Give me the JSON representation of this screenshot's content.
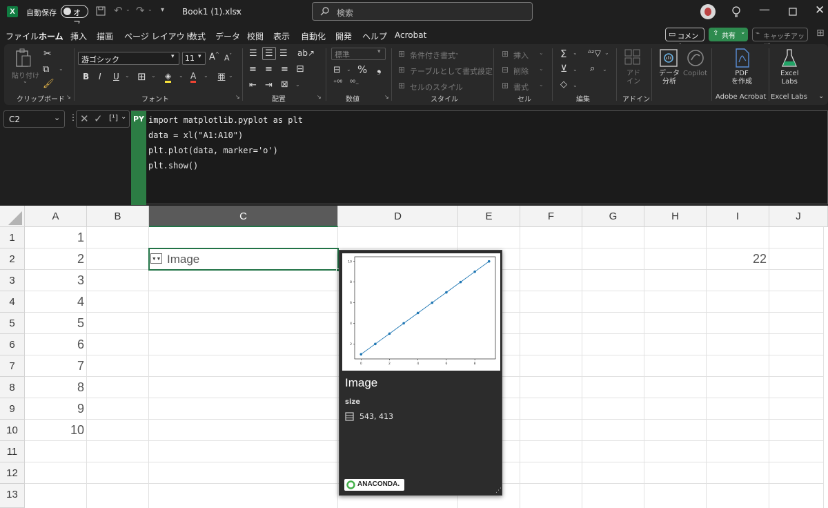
{
  "titlebar": {
    "autosave_label": "自動保存",
    "autosave_state": "オフ",
    "filename": "Book1 (1).xlsx",
    "search_placeholder": "検索"
  },
  "menu": {
    "tabs": [
      "ファイル",
      "ホーム",
      "挿入",
      "描画",
      "ページ レイアウト",
      "数式",
      "データ",
      "校閲",
      "表示",
      "自動化",
      "開発",
      "ヘルプ",
      "Acrobat"
    ],
    "active_tab": "ホーム",
    "comment_label": "コメント",
    "share_label": "共有",
    "catchup_label": "キャッチアップ"
  },
  "ribbon": {
    "paste_label": "貼り付け",
    "groups": {
      "clipboard": "クリップボード",
      "font": "フォント",
      "alignment": "配置",
      "number": "数値",
      "style": "スタイル",
      "cells": "セル",
      "editing": "編集",
      "addins": "アドイン",
      "acrobat": "Adobe Acrobat",
      "excellabs": "Excel Labs"
    },
    "font_name": "游ゴシック",
    "font_size": "11",
    "number_format": "標準",
    "conditional_format": "条件付き書式",
    "format_as_table": "テーブルとして書式設定",
    "cell_style": "セルのスタイル",
    "insert": "挿入",
    "delete": "削除",
    "format": "書式",
    "addin_label": "アド\nイン",
    "data_analysis": "データ\n分析",
    "copilot": "Copilot",
    "pdf_create": "PDF\nを作成",
    "excel_labs": "Excel\nLabs"
  },
  "formula": {
    "namebox": "C2",
    "py_badge": "PY",
    "lines": [
      "import matplotlib.pyplot as plt",
      "data = xl(\"A1:A10\")",
      "plt.plot(data, marker='o')",
      "plt.show()"
    ]
  },
  "grid": {
    "columns": [
      "A",
      "B",
      "C",
      "D",
      "E",
      "F",
      "G",
      "H",
      "I",
      "J"
    ],
    "rows": [
      "1",
      "2",
      "3",
      "4",
      "5",
      "6",
      "7",
      "8",
      "9",
      "10",
      "11",
      "12",
      "13"
    ],
    "colA_values": [
      "1",
      "2",
      "3",
      "4",
      "5",
      "6",
      "7",
      "8",
      "9",
      "10"
    ],
    "i2_value": "22",
    "c2_value": "Image"
  },
  "card": {
    "title": "Image",
    "size_label": "size",
    "size_value": "543, 413",
    "brand": "ANACONDA."
  },
  "chart_data": {
    "type": "line",
    "x": [
      0,
      1,
      2,
      3,
      4,
      5,
      6,
      7,
      8,
      9
    ],
    "values": [
      1,
      2,
      3,
      4,
      5,
      6,
      7,
      8,
      9,
      10
    ],
    "x_ticks": [
      "0",
      "2",
      "4",
      "6",
      "8"
    ],
    "y_ticks": [
      "2",
      "4",
      "6",
      "8",
      "10"
    ],
    "xlim": [
      -0.45,
      9.45
    ],
    "ylim": [
      0.55,
      10.45
    ],
    "color": "#1f77b4"
  }
}
